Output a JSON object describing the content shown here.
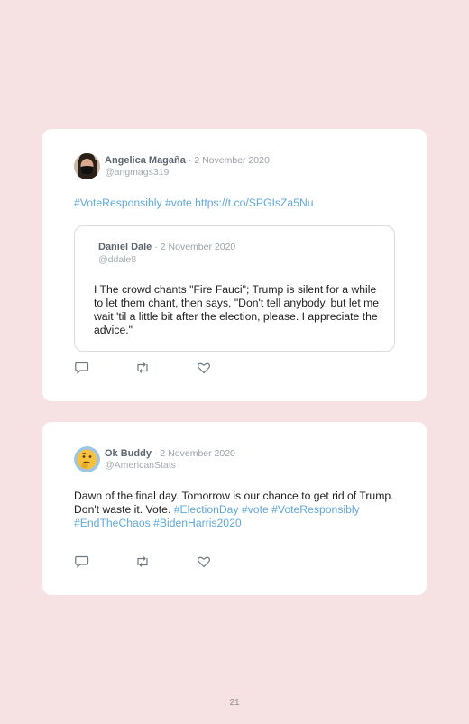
{
  "tweets": [
    {
      "name": "Angelica Magaña",
      "date": "· 2 November 2020",
      "handle": "@angmags319",
      "text_segments": [
        "#VoteResponsibly #vote https://t.co/SPGIsZa5Nu"
      ],
      "quoted": {
        "name": "Daniel Dale",
        "date": "· 2 November 2020",
        "handle": "@ddale8",
        "text": "I The crowd chants \"Fire Fauci\"; Trump is silent for a while to let them chant, then says, \"Don't tell anybody, but let me wait 'til a little bit after the election, please. I appreciate the advice.\""
      }
    },
    {
      "name": "Ok Buddy",
      "date": "· 2 November 2020",
      "handle": "@AmericanStats",
      "text_plain": "Dawn of the final day. Tomorrow is our chance to get rid of Trump. Don't waste it. Vote.",
      "text_tags": "#ElectionDay #vote #VoteResponsibly #EndTheChaos #BidenHarris2020"
    }
  ],
  "icons": [
    "reply-icon",
    "retweet-icon",
    "like-icon"
  ],
  "colors": {
    "background": "#f6e2e2",
    "card": "#ffffff",
    "link": "#5fa9de"
  },
  "page_number": "21"
}
